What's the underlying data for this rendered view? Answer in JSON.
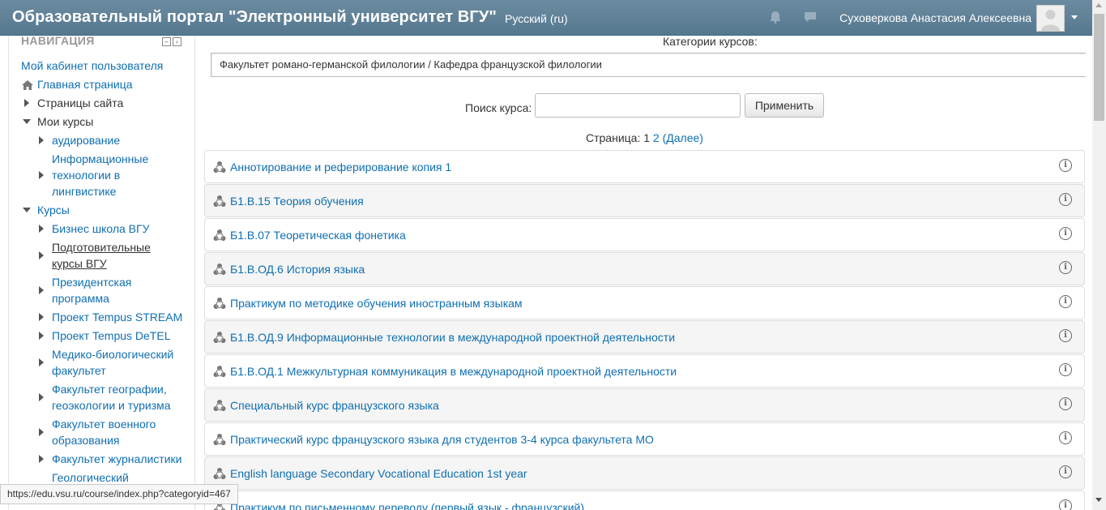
{
  "header": {
    "title": "Образовательный портал \"Электронный университет ВГУ\"",
    "language": "Русский (ru)",
    "user_name": "Суховеркова Анастасия Алексеевна",
    "bg_color": "#5f8197"
  },
  "navigation": {
    "title": "НАВИГАЦИЯ",
    "dashboard": "Мой кабинет пользователя",
    "home": "Главная страница",
    "site_pages": "Страницы сайта",
    "my_courses": "Мои курсы",
    "my_course_items": [
      "аудирование",
      "Информационные технологии в лингвистике"
    ],
    "courses": "Курсы",
    "course_categories": [
      "Бизнес школа ВГУ",
      "Подготовительные курсы ВГУ",
      "Президентская программа",
      "Проект Tempus STREAM",
      "Проект Tempus DeTEL",
      "Медико-биологический факультет",
      "Факультет географии, геоэкологии и туризма",
      "Факультет военного образования",
      "Факультет журналистики",
      "Геологический"
    ]
  },
  "main": {
    "category_label": "Категории курсов:",
    "category_value": "Факультет романо-германской филологии / Кафедра французской филологии",
    "search_label": "Поиск курса:",
    "search_value": "",
    "apply_button": "Применить",
    "pager": {
      "label": "Страница:",
      "current": "1",
      "next_page": "2",
      "next_label": "(Далее)"
    },
    "courses": [
      "Аннотирование и реферирование копия 1",
      "Б1.В.15 Теория обучения",
      "Б1.В.07 Теоретическая фонетика",
      "Б1.В.ОД.6 История языка",
      "Практикум по методике обучения иностранным языкам",
      "Б1.В.ОД.9 Информационные технологии в международной проектной деятельности",
      "Б1.В.ОД.1 Межкультурная коммуникация в международной проектной деятельности",
      "Специальный курс французского языка",
      "Практический курс французского языка для студентов 3-4 курса факультета МО",
      "English language Secondary Vocational Education 1st year",
      "Практикум по письменному переводу (первый язык - французский)"
    ]
  },
  "status_bar": {
    "url": "https://edu.vsu.ru/course/index.php?categoryid=467"
  },
  "colors": {
    "link": "#0f6fb1",
    "text": "#333333"
  },
  "icons": [
    "bell-icon",
    "chat-icon",
    "user-avatar",
    "course-icon",
    "info-icon",
    "home-icon"
  ]
}
